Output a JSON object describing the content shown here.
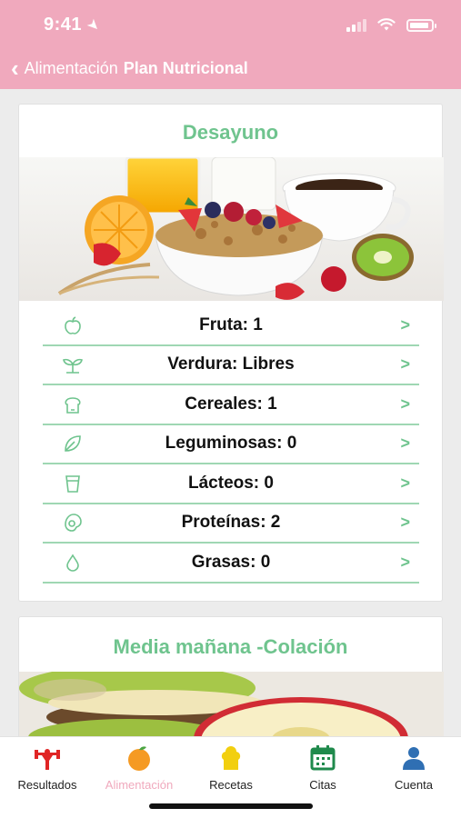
{
  "status": {
    "time": "9:41",
    "location_icon": "location-arrow-icon"
  },
  "nav": {
    "back_label": "Alimentación",
    "title": "Plan Nutricional"
  },
  "meals": [
    {
      "title": "Desayuno",
      "image": "breakfast-photo",
      "items": [
        {
          "label": "Fruta: 1",
          "icon": "apple-icon"
        },
        {
          "label": "Verdura: Libres",
          "icon": "sprout-icon"
        },
        {
          "label": "Cereales: 1",
          "icon": "bread-icon"
        },
        {
          "label": "Leguminosas: 0",
          "icon": "leaf-icon"
        },
        {
          "label": "Lácteos: 0",
          "icon": "glass-icon"
        },
        {
          "label": "Proteínas: 2",
          "icon": "protein-icon"
        },
        {
          "label": "Grasas: 0",
          "icon": "drop-icon"
        }
      ]
    },
    {
      "title": "Media mañana -Colación",
      "image": "apple-rings-photo"
    }
  ],
  "tabs": [
    {
      "label": "Resultados",
      "icon": "weightlifter-icon",
      "color": "#e02525"
    },
    {
      "label": "Alimentación",
      "icon": "orange-fruit-icon",
      "color": "#f59a23",
      "active": true
    },
    {
      "label": "Recetas",
      "icon": "chef-hat-icon",
      "color": "#f2cf0f"
    },
    {
      "label": "Citas",
      "icon": "calendar-icon",
      "color": "#1f8a4c"
    },
    {
      "label": "Cuenta",
      "icon": "person-icon",
      "color": "#2f6fb3"
    }
  ],
  "colors": {
    "header": "#f0a9bd",
    "accent_green": "#6fc48e",
    "divider": "#9fd7b3"
  }
}
